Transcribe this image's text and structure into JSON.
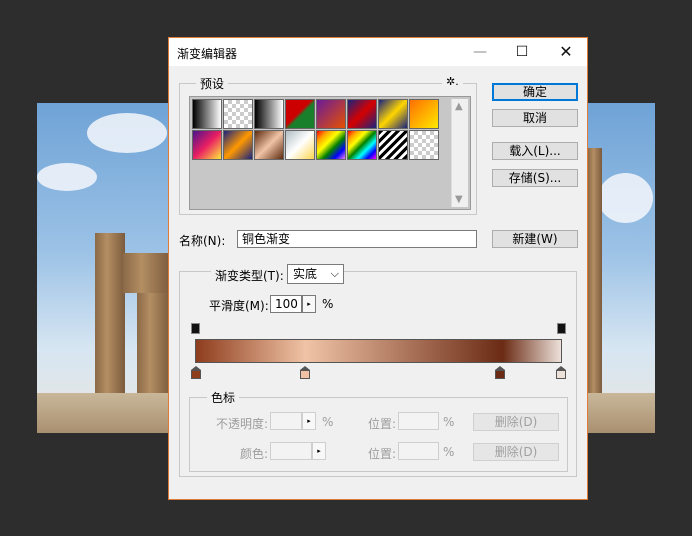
{
  "dialog": {
    "title": "渐变编辑器",
    "min_glyph": "—",
    "max_glyph": "☐",
    "close_glyph": "✕"
  },
  "presets": {
    "label": "预设",
    "gear_glyph": "✲.",
    "scroll_up": "▲",
    "scroll_down": "▼",
    "swatch_count": 16
  },
  "buttons": {
    "ok": "确定",
    "cancel": "取消",
    "load": "载入(L)...",
    "save": "存储(S)...",
    "new": "新建(W)"
  },
  "name": {
    "label": "名称(N):",
    "value": "铜色渐变"
  },
  "gradient_settings": {
    "type_label": "渐变类型(T):",
    "type_value": "实底",
    "type_arrow": "⌵",
    "smoothness_label": "平滑度(M):",
    "smoothness_value": "100",
    "smoothness_unit": "%",
    "spin_glyph": "▸"
  },
  "stops_group": {
    "label": "色标",
    "opacity_label": "不透明度:",
    "opacity_unit": "%",
    "opacity_location_label": "位置:",
    "opacity_location_unit": "%",
    "opacity_delete": "删除(D)",
    "color_label": "颜色:",
    "color_location_label": "位置:",
    "color_location_unit": "%",
    "color_delete": "删除(D)"
  },
  "colors": {
    "dialog_border": "#e07b39",
    "gradient": [
      "#8e3d1d",
      "#f0c3a6",
      "#6b2b14",
      "#ede1da"
    ]
  }
}
